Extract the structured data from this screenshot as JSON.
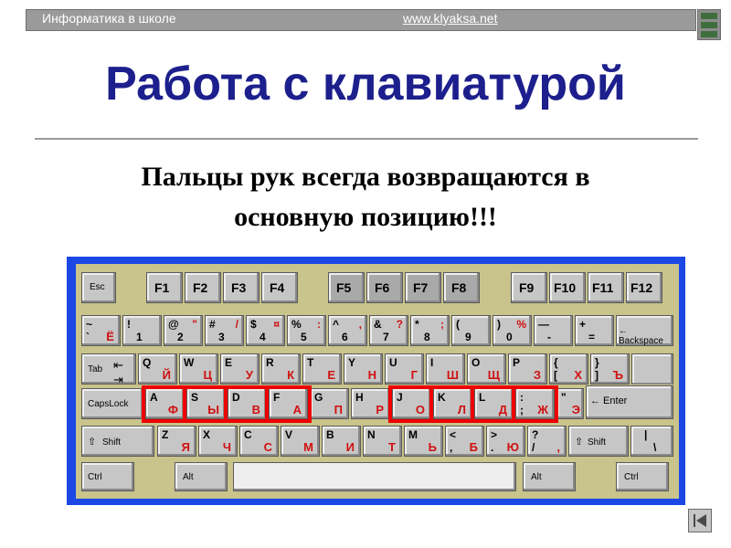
{
  "header": {
    "left_text": "Информатика в школе",
    "url": "www.klyaksa.net"
  },
  "title": "Работа с клавиатурой",
  "subtitle_line1": "Пальцы рук всегда возвращаются в",
  "subtitle_line2": "основную позицию!!!",
  "keys": {
    "esc": "Esc",
    "f1": "F1",
    "f2": "F2",
    "f3": "F3",
    "f4": "F4",
    "f5": "F5",
    "f6": "F6",
    "f7": "F7",
    "f8": "F8",
    "f9": "F9",
    "f10": "F10",
    "f11": "F11",
    "f12": "F12",
    "n0": {
      "top": "~",
      "bot": "`",
      "ru": "Ё"
    },
    "n1": {
      "top": "!",
      "bot": "1",
      "ru": ""
    },
    "n2": {
      "top": "@",
      "bot": "2",
      "ru": "\""
    },
    "n3": {
      "top": "#",
      "bot": "3",
      "ru": "/"
    },
    "n4": {
      "top": "$",
      "bot": "4",
      "ru": "¤"
    },
    "n5": {
      "top": "%",
      "bot": "5",
      "ru": ":"
    },
    "n6": {
      "top": "^",
      "bot": "6",
      "ru": ","
    },
    "n7": {
      "top": "&",
      "bot": "7",
      "ru": "?"
    },
    "n8": {
      "top": "*",
      "bot": "8",
      "ru": ";"
    },
    "n9": {
      "top": "(",
      "bot": "9",
      "ru": ""
    },
    "n10": {
      "top": ")",
      "bot": "0",
      "ru": "%"
    },
    "n11": {
      "top": "—",
      "bot": "-",
      "ru": ""
    },
    "n12": {
      "top": "+",
      "bot": "=",
      "ru": ""
    },
    "backspace": "← Backspace",
    "tab": "Tab",
    "q": {
      "en": "Q",
      "ru": "Й"
    },
    "w": {
      "en": "W",
      "ru": "Ц"
    },
    "e": {
      "en": "E",
      "ru": "У"
    },
    "r": {
      "en": "R",
      "ru": "К"
    },
    "t": {
      "en": "T",
      "ru": "Е"
    },
    "y": {
      "en": "Y",
      "ru": "Н"
    },
    "u": {
      "en": "U",
      "ru": "Г"
    },
    "i": {
      "en": "I",
      "ru": "Ш"
    },
    "o": {
      "en": "O",
      "ru": "Щ"
    },
    "p": {
      "en": "P",
      "ru": "З"
    },
    "lbr": {
      "top": "{",
      "bot": "[",
      "ru": "Х"
    },
    "rbr": {
      "top": "}",
      "bot": "]",
      "ru": "Ъ"
    },
    "capslock": "CapsLock",
    "a": {
      "en": "A",
      "ru": "Ф"
    },
    "s": {
      "en": "S",
      "ru": "Ы"
    },
    "d": {
      "en": "D",
      "ru": "В"
    },
    "f": {
      "en": "F",
      "ru": "А"
    },
    "g": {
      "en": "G",
      "ru": "П"
    },
    "h": {
      "en": "H",
      "ru": "Р"
    },
    "j": {
      "en": "J",
      "ru": "О"
    },
    "k": {
      "en": "K",
      "ru": "Л"
    },
    "l": {
      "en": "L",
      "ru": "Д"
    },
    "semi": {
      "top": ":",
      "bot": ";",
      "ru": "Ж"
    },
    "quote": {
      "top": "\"",
      "bot": "'",
      "ru": "Э"
    },
    "enter": "← Enter",
    "shift_left": "Shift",
    "z": {
      "en": "Z",
      "ru": "Я"
    },
    "x": {
      "en": "X",
      "ru": "Ч"
    },
    "c": {
      "en": "C",
      "ru": "С"
    },
    "v": {
      "en": "V",
      "ru": "М"
    },
    "b": {
      "en": "B",
      "ru": "И"
    },
    "n": {
      "en": "N",
      "ru": "Т"
    },
    "m": {
      "en": "M",
      "ru": "Ь"
    },
    "comma": {
      "top": "<",
      "bot": ",",
      "ru": "Б"
    },
    "period": {
      "top": ">",
      "bot": ".",
      "ru": "Ю"
    },
    "slash": {
      "top": "?",
      "bot": "/",
      "ru": ","
    },
    "shift_right": "Shift",
    "backslash": {
      "top": "|",
      "bot": "\\"
    },
    "ctrl_left": "Ctrl",
    "alt_left": "Alt",
    "alt_right": "Alt",
    "ctrl_right": "Ctrl"
  },
  "colors": {
    "frame": "#1b47e5",
    "board": "#c9c38c",
    "key": "#c6c6c6",
    "home_box": "#ee0000",
    "title": "#1c1f8c"
  },
  "nav": {
    "icon": "skip-back-icon"
  }
}
